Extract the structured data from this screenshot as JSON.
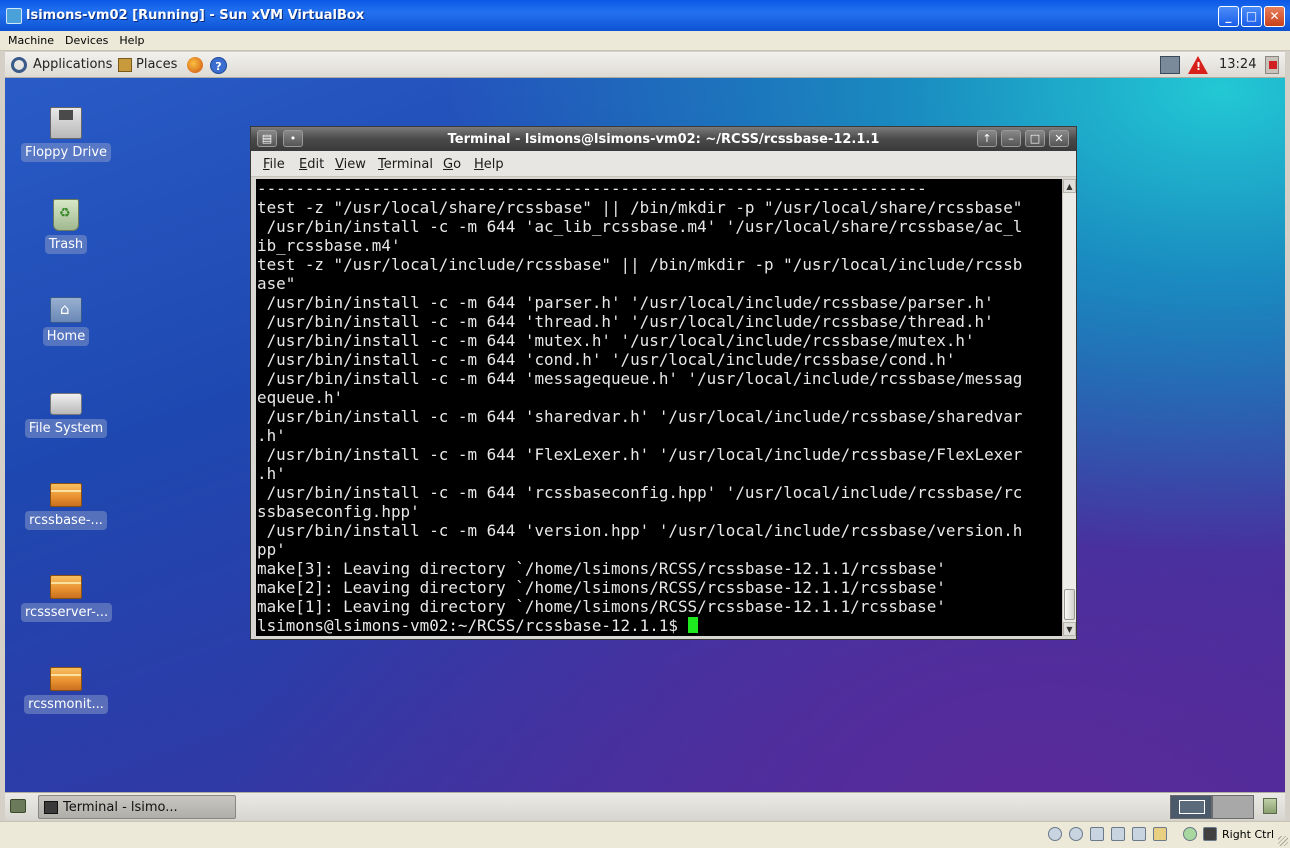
{
  "host": {
    "title": "lsimons-vm02 [Running] - Sun xVM VirtualBox",
    "window_buttons": {
      "minimize": "_",
      "maximize": "□",
      "close": "✕"
    },
    "menu": [
      "Machine",
      "Devices",
      "Help"
    ],
    "status_bar": {
      "icons": [
        "hard-disk-icon",
        "cd-icon",
        "floppy-icon",
        "network-icon",
        "usb-icon",
        "shared-folder-icon",
        "mouse-integration-icon",
        "keyboard-capture-icon"
      ],
      "host_key": "Right Ctrl"
    }
  },
  "guest": {
    "top_panel": {
      "applications": "Applications",
      "places": "Places",
      "help_glyph": "?",
      "warning_glyph": "!",
      "clock": "13:24"
    },
    "desktop_icons": [
      {
        "label": "Floppy Drive",
        "icon": "floppy-drive-icon"
      },
      {
        "label": "Trash",
        "icon": "trash-icon"
      },
      {
        "label": "Home",
        "icon": "home-folder-icon"
      },
      {
        "label": "File System",
        "icon": "file-system-icon"
      },
      {
        "label": "rcssbase-...",
        "icon": "package-icon"
      },
      {
        "label": "rcssserver-...",
        "icon": "package-icon"
      },
      {
        "label": "rcssmonit...",
        "icon": "package-icon"
      }
    ],
    "terminal": {
      "title": "Terminal - lsimons@lsimons-vm02: ~/RCSS/rcssbase-12.1.1",
      "menu": [
        {
          "label": "File",
          "mnemonic": "F",
          "rest": "ile"
        },
        {
          "label": "Edit",
          "mnemonic": "E",
          "rest": "dit"
        },
        {
          "label": "View",
          "mnemonic": "V",
          "rest": "iew"
        },
        {
          "label": "Terminal",
          "mnemonic": "T",
          "rest": "erminal"
        },
        {
          "label": "Go",
          "mnemonic": "G",
          "rest": "o"
        },
        {
          "label": "Help",
          "mnemonic": "H",
          "rest": "elp"
        }
      ],
      "lines": [
        "----------------------------------------------------------------------",
        "test -z \"/usr/local/share/rcssbase\" || /bin/mkdir -p \"/usr/local/share/rcssbase\"",
        " /usr/bin/install -c -m 644 'ac_lib_rcssbase.m4' '/usr/local/share/rcssbase/ac_l",
        "ib_rcssbase.m4'",
        "test -z \"/usr/local/include/rcssbase\" || /bin/mkdir -p \"/usr/local/include/rcssb",
        "ase\"",
        " /usr/bin/install -c -m 644 'parser.h' '/usr/local/include/rcssbase/parser.h'",
        " /usr/bin/install -c -m 644 'thread.h' '/usr/local/include/rcssbase/thread.h'",
        " /usr/bin/install -c -m 644 'mutex.h' '/usr/local/include/rcssbase/mutex.h'",
        " /usr/bin/install -c -m 644 'cond.h' '/usr/local/include/rcssbase/cond.h'",
        " /usr/bin/install -c -m 644 'messagequeue.h' '/usr/local/include/rcssbase/messag",
        "equeue.h'",
        " /usr/bin/install -c -m 644 'sharedvar.h' '/usr/local/include/rcssbase/sharedvar",
        ".h'",
        " /usr/bin/install -c -m 644 'FlexLexer.h' '/usr/local/include/rcssbase/FlexLexer",
        ".h'",
        " /usr/bin/install -c -m 644 'rcssbaseconfig.hpp' '/usr/local/include/rcssbase/rc",
        "ssbaseconfig.hpp'",
        " /usr/bin/install -c -m 644 'version.hpp' '/usr/local/include/rcssbase/version.h",
        "pp'",
        "make[3]: Leaving directory `/home/lsimons/RCSS/rcssbase-12.1.1/rcssbase'",
        "make[2]: Leaving directory `/home/lsimons/RCSS/rcssbase-12.1.1/rcssbase'",
        "make[1]: Leaving directory `/home/lsimons/RCSS/rcssbase-12.1.1/rcssbase'"
      ],
      "prompt": "lsimons@lsimons-vm02:~/RCSS/rcssbase-12.1.1$ ",
      "scroll_position": 1.0,
      "cursor_color": "#1ee81e"
    },
    "taskbar": {
      "tasks": [
        {
          "label": "Terminal - lsimo...",
          "active": true
        }
      ],
      "workspaces": 2,
      "active_workspace": 1
    }
  }
}
